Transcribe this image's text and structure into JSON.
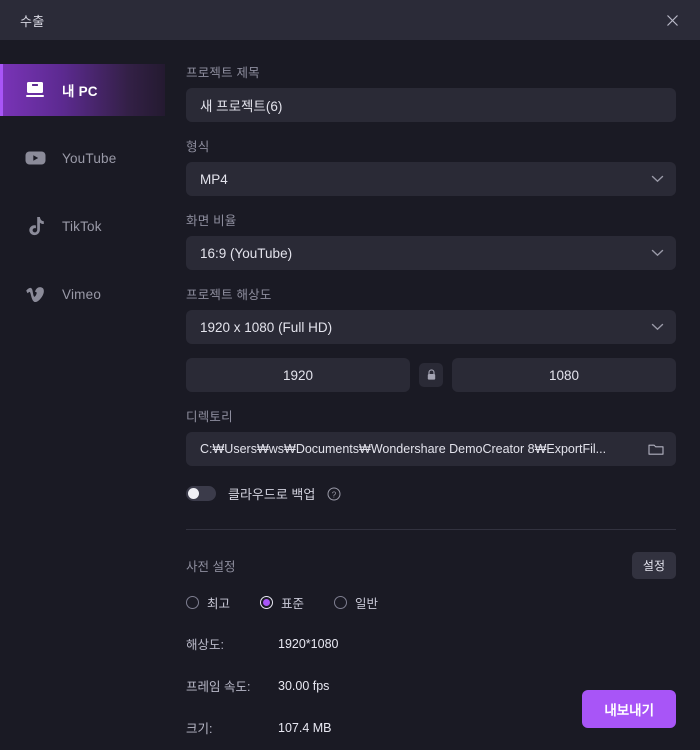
{
  "window": {
    "title": "수출",
    "close_icon": "close-icon"
  },
  "sidebar": {
    "items": [
      {
        "label": "내 PC",
        "icon": "monitor-icon",
        "active": true
      },
      {
        "label": "YouTube",
        "icon": "youtube-icon",
        "active": false
      },
      {
        "label": "TikTok",
        "icon": "tiktok-icon",
        "active": false
      },
      {
        "label": "Vimeo",
        "icon": "vimeo-icon",
        "active": false
      }
    ]
  },
  "form": {
    "project_title_label": "프로젝트 제목",
    "project_title_value": "새 프로젝트(6)",
    "project_title_placeholder": "새 프로젝트(6)",
    "format_label": "형식",
    "format_value": "MP4",
    "aspect_label": "화면 비율",
    "aspect_value": "16:9 (YouTube)",
    "resolution_label": "프로젝트 해상도",
    "resolution_value": "1920 x 1080 (Full HD)",
    "width_value": "1920",
    "height_value": "1080",
    "lock_icon": "lock-icon",
    "directory_label": "디렉토리",
    "directory_value": "C:₩Users₩ws₩Documents₩Wondershare DemoCreator 8₩ExportFil...",
    "folder_icon": "folder-icon",
    "cloud_backup_label": "클라우드로 백업",
    "cloud_backup_on": false,
    "help_icon": "help-circle-icon",
    "chevron_icon": "chevron-down-icon"
  },
  "preset": {
    "title": "사전 설정",
    "settings_button": "설정",
    "options": [
      {
        "label": "최고",
        "selected": false
      },
      {
        "label": "표준",
        "selected": true
      },
      {
        "label": "일반",
        "selected": false
      }
    ]
  },
  "info": [
    {
      "key": "해상도:",
      "value": "1920*1080"
    },
    {
      "key": "프레임 속도:",
      "value": "30.00 fps"
    },
    {
      "key": "크기:",
      "value": "107.4 MB"
    }
  ],
  "footer": {
    "export_label": "내보내기"
  },
  "colors": {
    "accent": "#a855f7",
    "panel": "#1a1a24",
    "titlebar": "#2b2b38",
    "field": "#2a2a36",
    "text": "#e3e3ec",
    "muted": "#8e8e9e"
  }
}
